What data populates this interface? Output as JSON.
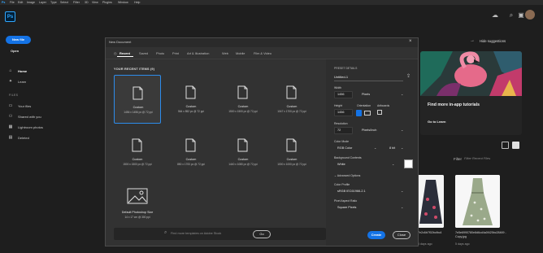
{
  "menubar": {
    "items": [
      "File",
      "Edit",
      "Image",
      "Layer",
      "Type",
      "Select",
      "Filter",
      "3D",
      "View",
      "Plugins",
      "Window",
      "Help"
    ]
  },
  "app": {
    "logo": "Ps"
  },
  "leftnav": {
    "new_file": "New file",
    "open": "Open",
    "home": "Home",
    "learn": "Learn",
    "files_heading": "FILES",
    "your_files": "Your files",
    "shared": "Shared with you",
    "lightroom": "Lightroom photos",
    "deleted": "Deleted"
  },
  "home": {
    "hide_suggestions": "Hide suggestions",
    "suggestion_title": "Find more in-app tutorials",
    "suggestion_link": "Go to Learn",
    "filter_label": "Filter",
    "filter_placeholder": "Filter Recent Files",
    "thumb_caption_1": "7e5e6990780e8d6cd4a0f425bc28469 - Copy.jpg",
    "thumb_date_1": "5 days ago",
    "thumb_caption_2": "7e2c6b7f02bcfbc4",
    "thumb_date_2": "5 days ago"
  },
  "dialog": {
    "title": "New Document",
    "tabs": [
      "Recent",
      "Saved",
      "Photo",
      "Print",
      "Art & Illustration",
      "Web",
      "Mobile",
      "Film & Video"
    ],
    "recent_heading": "YOUR RECENT ITEMS  (9)",
    "presets": [
      {
        "name": "Custom",
        "size": "1456 x 1456 px @ 72 ppi",
        "selected": true
      },
      {
        "name": "Custom",
        "size": "564 x 852 px @ 72 ppi"
      },
      {
        "name": "Custom",
        "size": "1500 x 1500 px @ 72 ppi"
      },
      {
        "name": "Custom",
        "size": "1047 x 1700 px @ 72 ppi"
      },
      {
        "name": "Custom",
        "size": "1500 x 1500 px @ 72 ppi"
      },
      {
        "name": "Custom",
        "size": "850 x 1700 px @ 72 ppi"
      },
      {
        "name": "Custom",
        "size": "1440 x 1080 px @ 72 ppi"
      },
      {
        "name": "Custom",
        "size": "1000 x 1000 px @ 72 ppi"
      },
      {
        "name": "Default Photoshop Size",
        "size": "14 x 17 cm @ 300 ppi"
      }
    ],
    "stock_placeholder": "Find more templates on Adobe Stock",
    "go": "Go",
    "preset_details": {
      "heading": "PRESET DETAILS",
      "name": "Untitled-1",
      "width_label": "Width",
      "width": "1456",
      "width_unit": "Pixels",
      "height_label": "Height",
      "height": "1456",
      "orientation_label": "Orientation",
      "artboards_label": "Artboards",
      "resolution_label": "Resolution",
      "resolution": "72",
      "resolution_unit": "Pixels/Inch",
      "color_mode_label": "Color Mode",
      "color_mode": "RGB Color",
      "bit_depth": "8 bit",
      "background_label": "Background Contents",
      "background": "White",
      "advanced_label": "Advanced Options",
      "color_profile_label": "Color Profile",
      "color_profile": "sRGB IEC61966-2.1",
      "pixel_ratio_label": "Pixel Aspect Ratio",
      "pixel_ratio": "Square Pixels"
    },
    "create": "Create",
    "close": "Close"
  },
  "colors": {
    "accent": "#1473e6",
    "selection": "#2d8ceb",
    "brand": "#31a8ff"
  }
}
